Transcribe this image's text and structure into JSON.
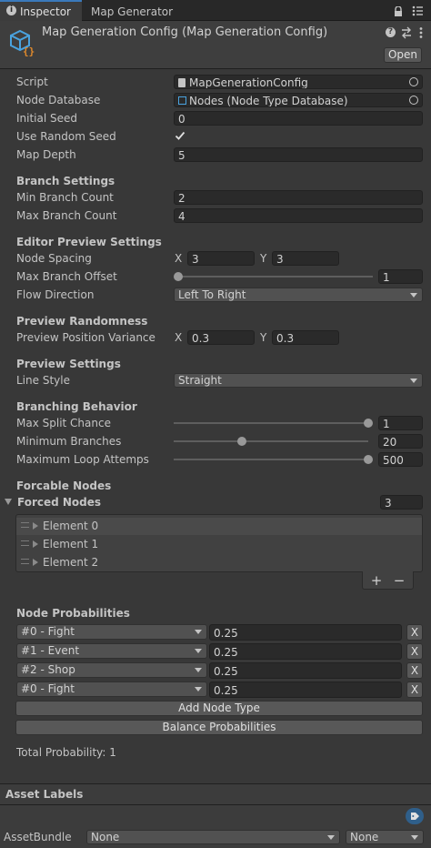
{
  "tabs": {
    "inspector": "Inspector",
    "map_generator": "Map Generator"
  },
  "header": {
    "title": "Map Generation Config (Map Generation Config)",
    "open_button": "Open"
  },
  "fields": {
    "script_label": "Script",
    "script_value": "MapGenerationConfig",
    "node_database_label": "Node Database",
    "node_database_value": "Nodes (Node Type Database)",
    "initial_seed_label": "Initial Seed",
    "initial_seed_value": "0",
    "use_random_seed_label": "Use Random Seed",
    "use_random_seed_checked": true,
    "map_depth_label": "Map Depth",
    "map_depth_value": "5"
  },
  "branch_settings": {
    "header": "Branch Settings",
    "min_label": "Min Branch Count",
    "min_value": "2",
    "max_label": "Max Branch Count",
    "max_value": "4"
  },
  "editor_preview": {
    "header": "Editor Preview Settings",
    "node_spacing_label": "Node Spacing",
    "node_spacing_x": "3",
    "node_spacing_y": "3",
    "max_branch_offset_label": "Max Branch Offset",
    "max_branch_offset_value": "1",
    "max_branch_offset_level": 0.0,
    "flow_direction_label": "Flow Direction",
    "flow_direction_value": "Left To Right"
  },
  "preview_randomness": {
    "header": "Preview Randomness",
    "variance_label": "Preview Position Variance",
    "variance_x": "0.3",
    "variance_y": "0.3"
  },
  "preview_settings": {
    "header": "Preview Settings",
    "line_style_label": "Line Style",
    "line_style_value": "Straight"
  },
  "branching_behavior": {
    "header": "Branching Behavior",
    "max_split_label": "Max Split Chance",
    "max_split_value": "1",
    "max_split_level": 1.0,
    "min_branches_label": "Minimum Branches",
    "min_branches_value": "20",
    "min_branches_level": 0.35,
    "max_loop_label": "Maximum Loop Attemps",
    "max_loop_value": "500",
    "max_loop_level": 1.0
  },
  "forcable_nodes": {
    "header": "Forcable Nodes",
    "forced_label": "Forced Nodes",
    "forced_count": "3",
    "elements": [
      "Element 0",
      "Element 1",
      "Element 2"
    ],
    "add": "+",
    "remove": "−"
  },
  "node_probabilities": {
    "header": "Node Probabilities",
    "rows": [
      {
        "type": "#0 - Fight",
        "value": "0.25"
      },
      {
        "type": "#1 - Event",
        "value": "0.25"
      },
      {
        "type": "#2 - Shop",
        "value": "0.25"
      },
      {
        "type": "#0 - Fight",
        "value": "0.25"
      }
    ],
    "remove_label": "X",
    "add_button": "Add Node Type",
    "balance_button": "Balance Probabilities",
    "total": "Total Probability: 1"
  },
  "asset_labels": {
    "header": "Asset Labels",
    "assetbundle_label": "AssetBundle",
    "bundle_value": "None",
    "variant_value": "None"
  },
  "colors": {
    "background": "#383838",
    "tab_bar": "#282828",
    "field": "#2a2a2a",
    "icon_blue": "#4aa3df",
    "icon_orange": "#e08a2c"
  }
}
